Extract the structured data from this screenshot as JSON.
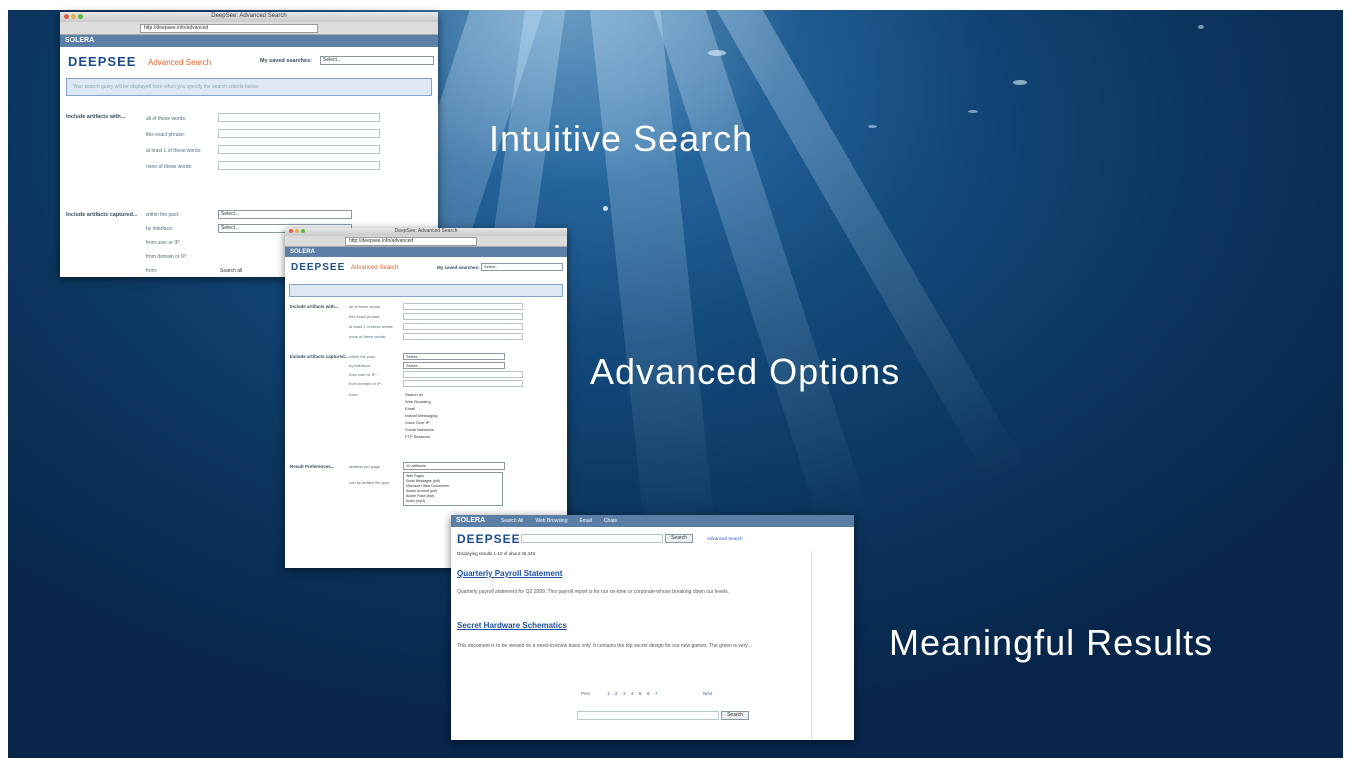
{
  "captions": {
    "intuitive": "Intuitive Search",
    "advanced": "Advanced Options",
    "meaningful": "Meaningful Results"
  },
  "shot1": {
    "window_title": "DeepSee: Advanced Search",
    "url": "http://deepsee.info/advanced",
    "nav_brand": "SOLERA",
    "logo": "DEEPSEE",
    "page_title": "Advanced Search",
    "saved_searches_label": "My saved searches:",
    "saved_select": "Select...",
    "query_hint": "Your search query will be displayed here when you specify the search criteria below.",
    "section1_label": "Include artifacts with...",
    "rows1": [
      "all of these words:",
      "this exact phrase:",
      "at least 1 of these words:",
      "none of these words:"
    ],
    "section2_label": "Include artifacts captured...",
    "rows2": [
      "within the past:",
      "by interface:",
      "from user or IP:",
      "from domain or IP:",
      "from:"
    ],
    "select_default": "Select...",
    "radio_label": "Search all"
  },
  "shot2": {
    "window_title": "DeepSee: Advanced Search",
    "url": "http://deepsee.info/advanced",
    "nav_brand": "SOLERA",
    "logo": "DEEPSEE",
    "page_title": "Advanced Search",
    "saved_searches_label": "My saved searches:",
    "saved_select": "Select...",
    "section1_label": "Include artifacts with...",
    "rows1": [
      "all of these words:",
      "this exact phrase:",
      "at least 1 of these words:",
      "none of these words:"
    ],
    "section2_label": "Include artifacts captured...",
    "rows2": [
      "within the past:",
      "by interface:",
      "from user or IP:",
      "from domain or IP:",
      "from:"
    ],
    "checklist": [
      "Search all",
      "Web Browsing",
      "Email",
      "Instant Messaging",
      "Voice Over IP",
      "Social Networks",
      "FTP Sessions"
    ],
    "section3_label": "Result Preferences...",
    "rows3": [
      "artifacts per page:",
      "sort by artifact file type:"
    ],
    "per_page_select": "10 artifacts",
    "type_options": [
      "Web Pages",
      "Email Messages (pdf)",
      "Microsoft Office Documents",
      "Adobe Acrobat (pdf)",
      "Adobe Flash (swf)",
      "Audio (mp3)"
    ]
  },
  "shot3": {
    "nav_brand": "SOLERA",
    "nav_items": [
      "Search All",
      "Web Browsing",
      "Email",
      "Chats"
    ],
    "logo": "DEEPSEE",
    "search_button": "Search",
    "advanced_link": "Advanced Search",
    "results_summary": "Displaying results 1-10 of about 36,349",
    "result1_title": "Quarterly Payroll Statement",
    "result1_text": "Quarterly payroll statement for Q2 2009. This payroll report is for our on-time or corporate-whose breaking down our levels.",
    "result2_title": "Secret Hardware Schematics",
    "result2_text": "This document is to be viewed on a need-to-know basis only. It contains the top secret design for our new games. The green is very...",
    "pages": [
      "1",
      "2",
      "3",
      "4",
      "5",
      "6",
      "7"
    ],
    "prev_label": "Prev",
    "next_label": "Next",
    "bottom_search_button": "Search"
  }
}
